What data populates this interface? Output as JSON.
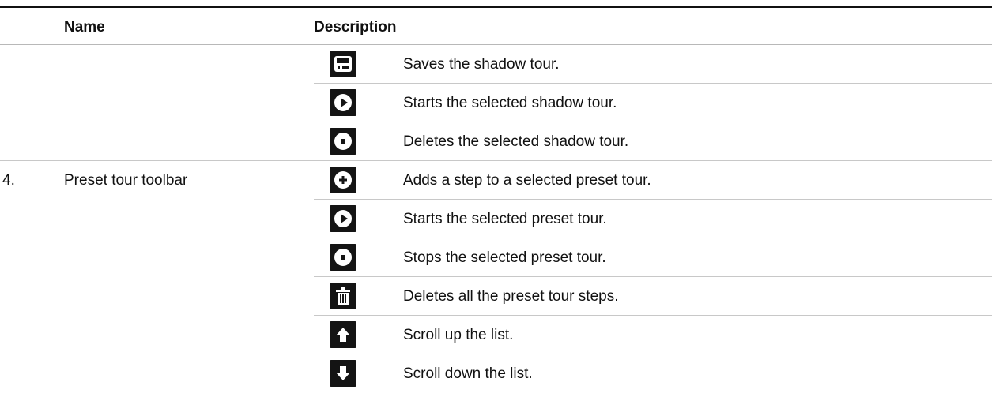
{
  "headers": {
    "name": "Name",
    "description": "Description"
  },
  "shadow_rows": [
    {
      "icon": "save-icon",
      "description": "Saves the shadow tour."
    },
    {
      "icon": "play-icon",
      "description": "Starts the selected shadow tour."
    },
    {
      "icon": "stop-icon",
      "description": "Deletes the selected shadow tour."
    }
  ],
  "preset_group": {
    "number": "4.",
    "name": "Preset tour toolbar",
    "rows": [
      {
        "icon": "add-step-icon",
        "description": "Adds a step to a selected preset tour."
      },
      {
        "icon": "play-icon",
        "description": "Starts the selected preset tour."
      },
      {
        "icon": "stop-icon",
        "description": "Stops the selected preset tour."
      },
      {
        "icon": "trash-icon",
        "description": "Deletes all the preset tour steps."
      },
      {
        "icon": "arrow-up-icon",
        "description": "Scroll up the list."
      },
      {
        "icon": "arrow-down-icon",
        "description": "Scroll down the list."
      }
    ]
  }
}
